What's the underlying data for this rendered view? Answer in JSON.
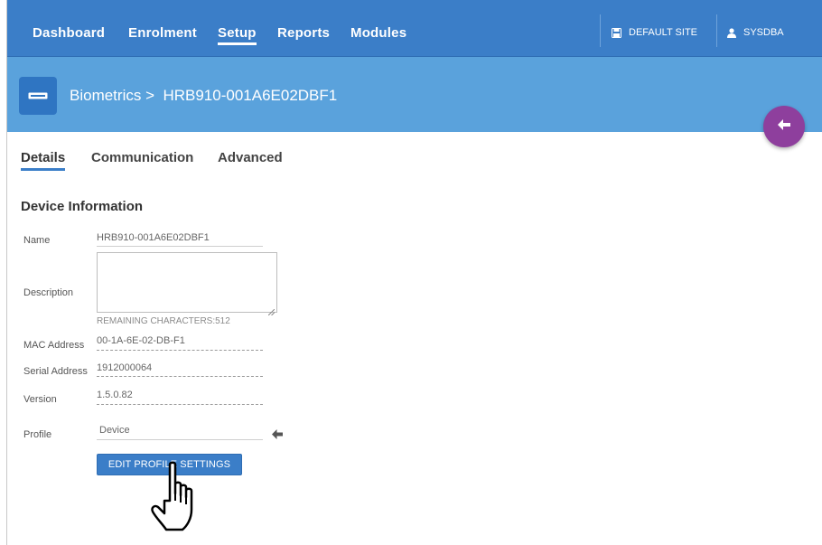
{
  "nav": {
    "items": [
      "Dashboard",
      "Enrolment",
      "Setup",
      "Reports",
      "Modules"
    ],
    "active": "Setup",
    "site_label": "DEFAULT SITE",
    "user_label": "SYSDBA"
  },
  "header": {
    "breadcrumb": "Biometrics >  HRB910-001A6E02DBF1"
  },
  "tabs": [
    "Details",
    "Communication",
    "Advanced"
  ],
  "section": {
    "title": "Device Information"
  },
  "form": {
    "name_label": "Name",
    "name_value": "HRB910-001A6E02DBF1",
    "description_label": "Description",
    "description_value": "",
    "remaining": "REMAINING CHARACTERS:512",
    "mac_label": "MAC Address",
    "mac_value": "00-1A-6E-02-DB-F1",
    "serial_label": "Serial Address",
    "serial_value": "1912000064",
    "version_label": "Version",
    "version_value": "1.5.0.82",
    "profile_label": "Profile",
    "profile_value": "Device",
    "edit_button": "EDIT PROFILE SETTINGS"
  },
  "colors": {
    "nav_bg": "#3b7ec8",
    "header_bg": "#5aa2dc",
    "fab_bg": "#8e3f9d",
    "button_bg": "#3b7ec8"
  },
  "icons": [
    "device-icon",
    "save-icon",
    "user-icon",
    "arrow-left-icon",
    "hand-pointer-icon",
    "resize-grip-icon"
  ]
}
